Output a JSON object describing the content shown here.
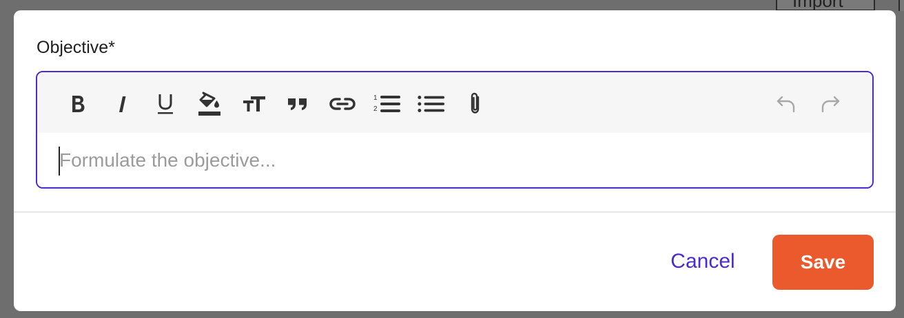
{
  "backdrop": {
    "import_label": "Import"
  },
  "modal": {
    "field_label": "Objective*",
    "placeholder": "Formulate the objective...",
    "toolbar": [
      {
        "name": "bold-button",
        "icon": "bold-icon",
        "enabled": true
      },
      {
        "name": "italic-button",
        "icon": "italic-icon",
        "enabled": true
      },
      {
        "name": "underline-button",
        "icon": "underline-icon",
        "enabled": true
      },
      {
        "name": "highlight-button",
        "icon": "paint-bucket-icon",
        "enabled": true
      },
      {
        "name": "text-size-button",
        "icon": "text-size-icon",
        "enabled": true
      },
      {
        "name": "quote-button",
        "icon": "quote-icon",
        "enabled": true
      },
      {
        "name": "link-button",
        "icon": "link-icon",
        "enabled": true
      },
      {
        "name": "ordered-list-button",
        "icon": "ordered-list-icon",
        "enabled": true
      },
      {
        "name": "bullet-list-button",
        "icon": "bullet-list-icon",
        "enabled": true
      },
      {
        "name": "attach-button",
        "icon": "paperclip-icon",
        "enabled": true
      },
      {
        "name": "undo-button",
        "icon": "undo-icon",
        "enabled": false
      },
      {
        "name": "redo-button",
        "icon": "redo-icon",
        "enabled": false
      }
    ],
    "cancel_label": "Cancel",
    "save_label": "Save"
  },
  "colors": {
    "accent": "#4a2bd1",
    "primary_button": "#ea5a2c",
    "toolbar_bg": "#f6f6f6",
    "placeholder": "#9b9b9b"
  }
}
